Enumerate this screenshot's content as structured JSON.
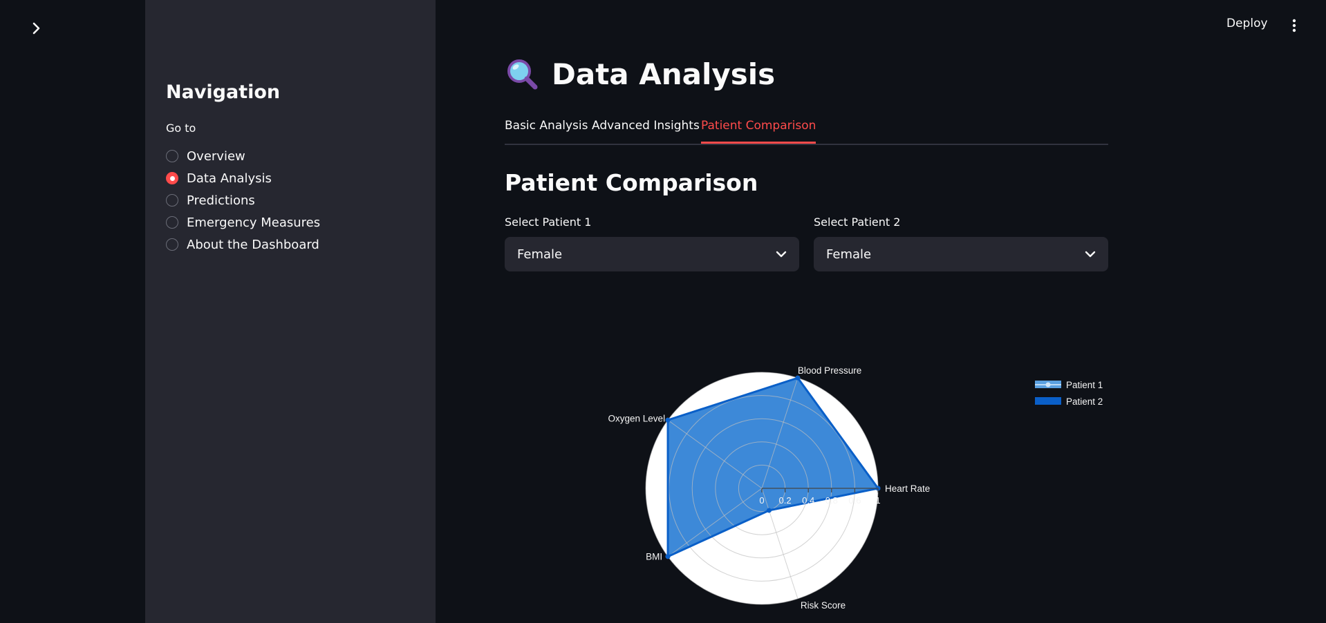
{
  "sidebar": {
    "title": "Navigation",
    "radio_label": "Go to",
    "items": [
      {
        "label": "Overview",
        "checked": false
      },
      {
        "label": "Data Analysis",
        "checked": true
      },
      {
        "label": "Predictions",
        "checked": false
      },
      {
        "label": "Emergency Measures",
        "checked": false
      },
      {
        "label": "About the Dashboard",
        "checked": false
      }
    ]
  },
  "header": {
    "deploy_label": "Deploy"
  },
  "main": {
    "title_icon": "magnifying-glass-icon",
    "title": "Data Analysis",
    "tabs": [
      {
        "label": "Basic Analysis",
        "active": false
      },
      {
        "label": "Advanced Insights",
        "active": false
      },
      {
        "label": "Patient Comparison",
        "active": true
      }
    ],
    "section_title": "Patient Comparison",
    "select1": {
      "label": "Select Patient 1",
      "value": "Female"
    },
    "select2": {
      "label": "Select Patient 2",
      "value": "Female"
    }
  },
  "colors": {
    "accent": "#ff4b4b",
    "background": "#0e1117",
    "sidebar": "#262730",
    "patient1": "#5aa0e0",
    "patient2": "#0a5fc8"
  },
  "chart_data": {
    "type": "radar",
    "axes": [
      "Heart Rate",
      "Blood Pressure",
      "Oxygen Level",
      "BMI",
      "Risk Score"
    ],
    "radial_ticks": [
      "0",
      "0.2",
      "0.4",
      "0.8",
      "0.6",
      "1"
    ],
    "radial_tick_values": [
      0,
      0.2,
      0.4,
      0.6,
      0.8,
      1
    ],
    "rmax": 1,
    "series": [
      {
        "name": "Patient 1",
        "values": [
          1,
          1,
          1,
          1,
          0.2
        ]
      },
      {
        "name": "Patient 2",
        "values": [
          1,
          1,
          1,
          1,
          0.2
        ]
      }
    ],
    "legend": [
      "Patient 1",
      "Patient 2"
    ],
    "legend_position": "top-right"
  }
}
